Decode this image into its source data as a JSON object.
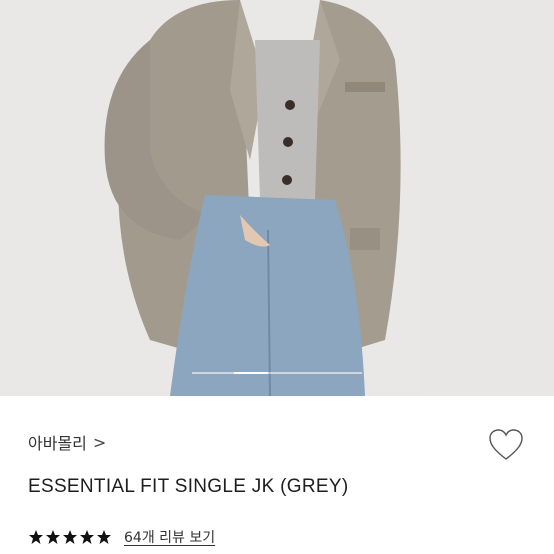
{
  "product": {
    "brand": "아바몰리",
    "brand_chevron": ">",
    "name": "ESSENTIAL FIT SINGLE JK (GREY)",
    "rating": 5,
    "rating_max": 5,
    "review_link": "64개 리뷰 보기"
  },
  "gallery": {
    "image_icon": "product-photo",
    "active_slide_fraction": 0.25
  },
  "icons": {
    "favorite": "heart-outline-icon",
    "star": "star-filled-icon"
  },
  "colors": {
    "star": "#111111",
    "text": "#222222"
  }
}
